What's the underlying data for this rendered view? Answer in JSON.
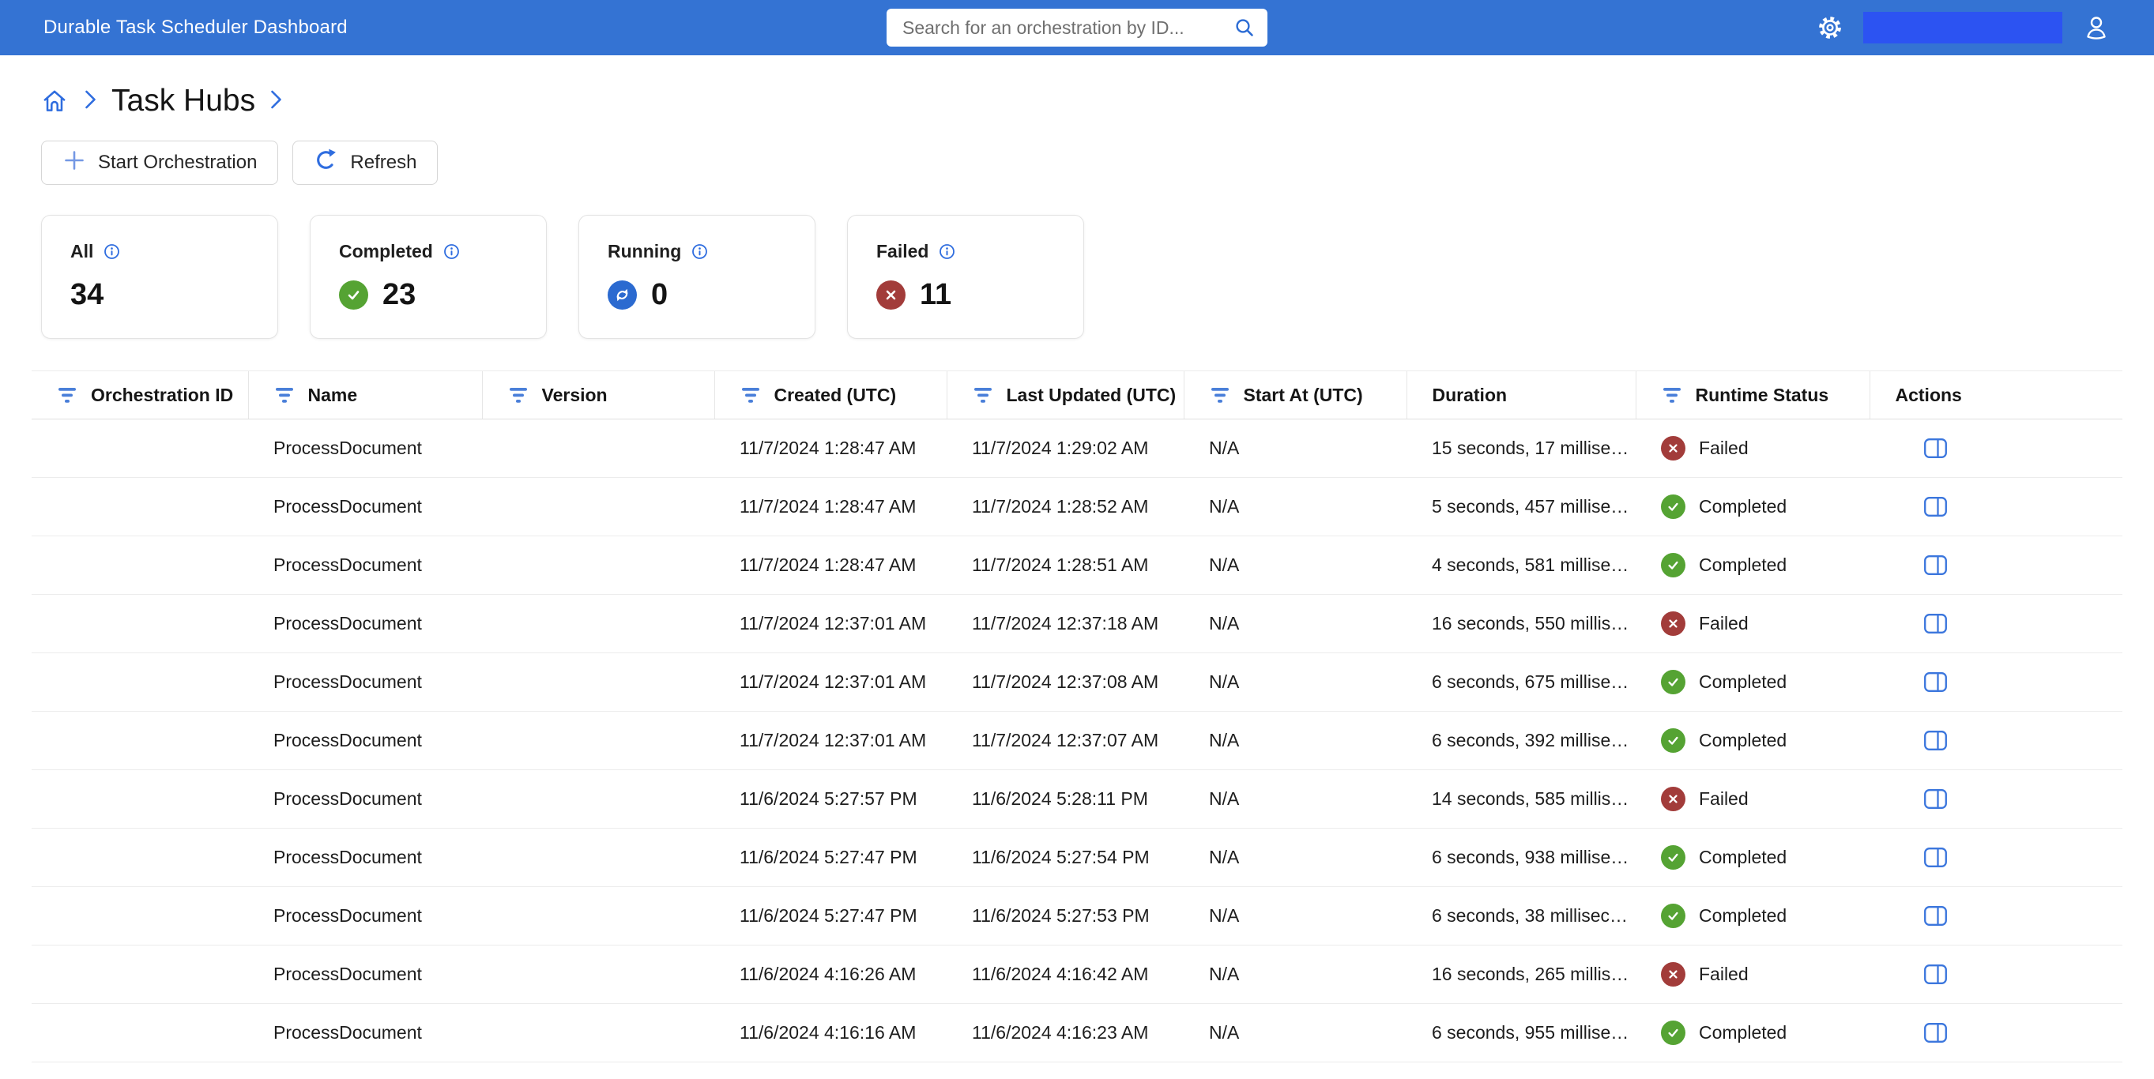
{
  "topbar": {
    "title": "Durable Task Scheduler Dashboard",
    "search_placeholder": "Search for an orchestration by ID...",
    "bg_color": "#3473d3",
    "redaction_color": "#2c53f2",
    "icons": [
      "search-icon",
      "gear-icon",
      "person-icon"
    ]
  },
  "breadcrumb": {
    "home_icon": "home-icon",
    "current": "Task Hubs"
  },
  "toolbar": {
    "start_orchestration_label": "Start Orchestration",
    "refresh_label": "Refresh"
  },
  "stat_cards": [
    {
      "id": "all",
      "label": "All",
      "value": "34",
      "icon": null,
      "icon_color": null
    },
    {
      "id": "completed",
      "label": "Completed",
      "value": "23",
      "icon": "check-circle",
      "icon_color": "#55a333"
    },
    {
      "id": "running",
      "label": "Running",
      "value": "0",
      "icon": "sync-circle",
      "icon_color": "#2b6ad0"
    },
    {
      "id": "failed",
      "label": "Failed",
      "value": "11",
      "icon": "x-circle",
      "icon_color": "#a23c3a"
    }
  ],
  "table": {
    "columns": [
      {
        "label": "Orchestration ID",
        "filter": true
      },
      {
        "label": "Name",
        "filter": true
      },
      {
        "label": "Version",
        "filter": true
      },
      {
        "label": "Created (UTC)",
        "filter": true
      },
      {
        "label": "Last Updated (UTC)",
        "filter": true
      },
      {
        "label": "Start At (UTC)",
        "filter": true
      },
      {
        "label": "Duration",
        "filter": false
      },
      {
        "label": "Runtime Status",
        "filter": true
      },
      {
        "label": "Actions",
        "filter": false
      }
    ],
    "status_colors": {
      "Completed": "#55a333",
      "Failed": "#a23c3a",
      "Running": "#2b6ad0"
    },
    "rows": [
      {
        "orchestration_id": "",
        "name": "ProcessDocument",
        "version": "",
        "created": "11/7/2024 1:28:47 AM",
        "last_updated": "11/7/2024 1:29:02 AM",
        "start_at": "N/A",
        "duration": "15 seconds, 17 millise…",
        "status": "Failed"
      },
      {
        "orchestration_id": "",
        "name": "ProcessDocument",
        "version": "",
        "created": "11/7/2024 1:28:47 AM",
        "last_updated": "11/7/2024 1:28:52 AM",
        "start_at": "N/A",
        "duration": "5 seconds, 457 millise…",
        "status": "Completed"
      },
      {
        "orchestration_id": "",
        "name": "ProcessDocument",
        "version": "",
        "created": "11/7/2024 1:28:47 AM",
        "last_updated": "11/7/2024 1:28:51 AM",
        "start_at": "N/A",
        "duration": "4 seconds, 581 millise…",
        "status": "Completed"
      },
      {
        "orchestration_id": "",
        "name": "ProcessDocument",
        "version": "",
        "created": "11/7/2024 12:37:01 AM",
        "last_updated": "11/7/2024 12:37:18 AM",
        "start_at": "N/A",
        "duration": "16 seconds, 550 millis…",
        "status": "Failed"
      },
      {
        "orchestration_id": "",
        "name": "ProcessDocument",
        "version": "",
        "created": "11/7/2024 12:37:01 AM",
        "last_updated": "11/7/2024 12:37:08 AM",
        "start_at": "N/A",
        "duration": "6 seconds, 675 millise…",
        "status": "Completed"
      },
      {
        "orchestration_id": "",
        "name": "ProcessDocument",
        "version": "",
        "created": "11/7/2024 12:37:01 AM",
        "last_updated": "11/7/2024 12:37:07 AM",
        "start_at": "N/A",
        "duration": "6 seconds, 392 millise…",
        "status": "Completed"
      },
      {
        "orchestration_id": "",
        "name": "ProcessDocument",
        "version": "",
        "created": "11/6/2024 5:27:57 PM",
        "last_updated": "11/6/2024 5:28:11 PM",
        "start_at": "N/A",
        "duration": "14 seconds, 585 millis…",
        "status": "Failed"
      },
      {
        "orchestration_id": "",
        "name": "ProcessDocument",
        "version": "",
        "created": "11/6/2024 5:27:47 PM",
        "last_updated": "11/6/2024 5:27:54 PM",
        "start_at": "N/A",
        "duration": "6 seconds, 938 millise…",
        "status": "Completed"
      },
      {
        "orchestration_id": "",
        "name": "ProcessDocument",
        "version": "",
        "created": "11/6/2024 5:27:47 PM",
        "last_updated": "11/6/2024 5:27:53 PM",
        "start_at": "N/A",
        "duration": "6 seconds, 38 millisec…",
        "status": "Completed"
      },
      {
        "orchestration_id": "",
        "name": "ProcessDocument",
        "version": "",
        "created": "11/6/2024 4:16:26 AM",
        "last_updated": "11/6/2024 4:16:42 AM",
        "start_at": "N/A",
        "duration": "16 seconds, 265 millis…",
        "status": "Failed"
      },
      {
        "orchestration_id": "",
        "name": "ProcessDocument",
        "version": "",
        "created": "11/6/2024 4:16:16 AM",
        "last_updated": "11/6/2024 4:16:23 AM",
        "start_at": "N/A",
        "duration": "6 seconds, 955 millise…",
        "status": "Completed"
      }
    ]
  }
}
